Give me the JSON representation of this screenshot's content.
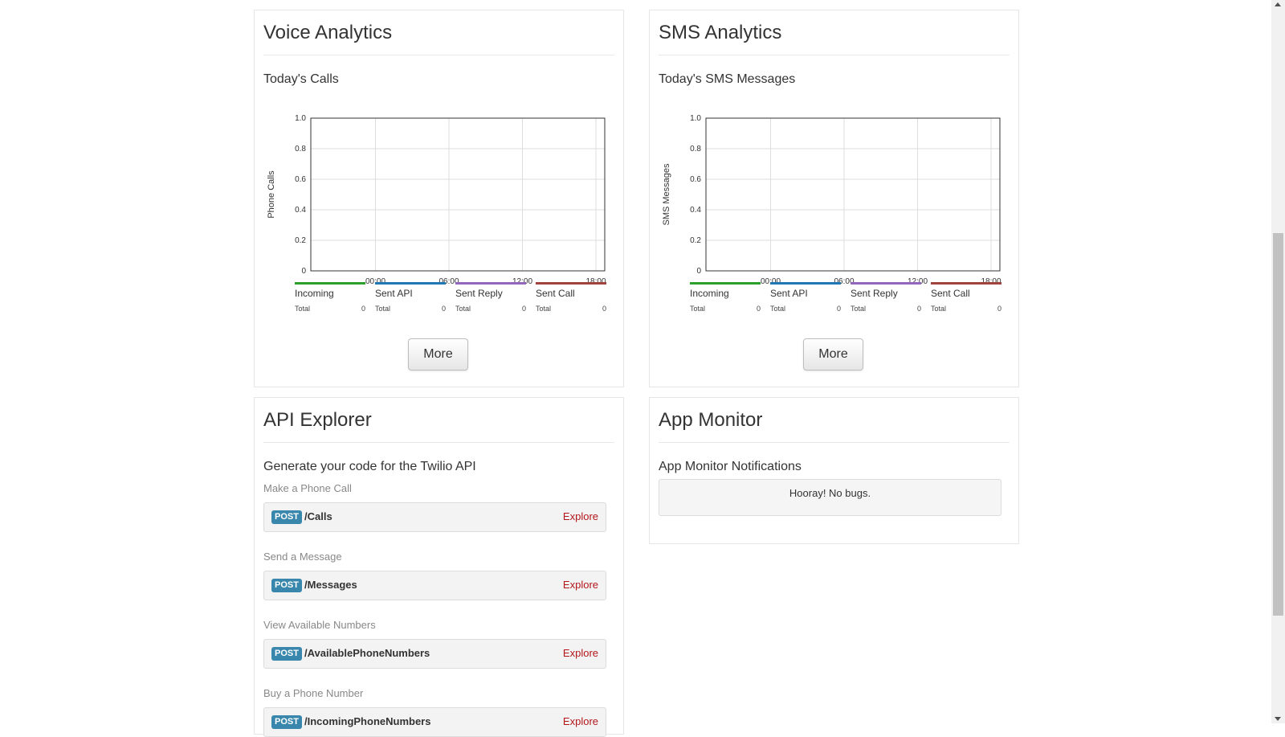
{
  "voice": {
    "title": "Voice Analytics",
    "subtitle": "Today's Calls",
    "more_label": "More",
    "legend": [
      {
        "name": "Incoming",
        "total_label": "Total",
        "total": "0",
        "color": "#2ca02c"
      },
      {
        "name": "Sent API",
        "total_label": "Total",
        "total": "0",
        "color": "#1f77b4"
      },
      {
        "name": "Sent Reply",
        "total_label": "Total",
        "total": "0",
        "color": "#9467bd"
      },
      {
        "name": "Sent Call",
        "total_label": "Total",
        "total": "0",
        "color": "#a0423d"
      }
    ]
  },
  "sms": {
    "title": "SMS Analytics",
    "subtitle": "Today's SMS Messages",
    "more_label": "More",
    "legend": [
      {
        "name": "Incoming",
        "total_label": "Total",
        "total": "0",
        "color": "#2ca02c"
      },
      {
        "name": "Sent API",
        "total_label": "Total",
        "total": "0",
        "color": "#1f77b4"
      },
      {
        "name": "Sent Reply",
        "total_label": "Total",
        "total": "0",
        "color": "#9467bd"
      },
      {
        "name": "Sent Call",
        "total_label": "Total",
        "total": "0",
        "color": "#a0423d"
      }
    ]
  },
  "api_explorer": {
    "title": "API Explorer",
    "subtitle": "Generate your code for the Twilio API",
    "items": [
      {
        "label": "Make a Phone Call",
        "method": "POST",
        "path": "/Calls",
        "action": "Explore"
      },
      {
        "label": "Send a Message",
        "method": "POST",
        "path": "/Messages",
        "action": "Explore"
      },
      {
        "label": "View Available Numbers",
        "method": "POST",
        "path": "/AvailablePhoneNumbers",
        "action": "Explore"
      },
      {
        "label": "Buy a Phone Number",
        "method": "POST",
        "path": "/IncomingPhoneNumbers",
        "action": "Explore"
      }
    ]
  },
  "app_monitor": {
    "title": "App Monitor",
    "subtitle": "App Monitor Notifications",
    "message": "Hooray! No bugs."
  },
  "chart_data": [
    {
      "type": "line",
      "ylabel": "Phone Calls",
      "xlabel": "",
      "x_ticks": [
        "00:00",
        "06:00",
        "12:00",
        "18:00"
      ],
      "y_ticks": [
        "0",
        "0.2",
        "0.4",
        "0.6",
        "0.8",
        "1.0"
      ],
      "ylim": [
        0,
        1.0
      ],
      "grid": true,
      "legend_placement": "bottom",
      "series": [
        {
          "name": "Incoming",
          "values": []
        },
        {
          "name": "Sent API",
          "values": []
        },
        {
          "name": "Sent Reply",
          "values": []
        },
        {
          "name": "Sent Call",
          "values": []
        }
      ]
    },
    {
      "type": "line",
      "ylabel": "SMS Messages",
      "xlabel": "",
      "x_ticks": [
        "00:00",
        "06:00",
        "12:00",
        "18:00"
      ],
      "y_ticks": [
        "0",
        "0.2",
        "0.4",
        "0.6",
        "0.8",
        "1.0"
      ],
      "ylim": [
        0,
        1.0
      ],
      "grid": true,
      "legend_placement": "bottom",
      "series": [
        {
          "name": "Incoming",
          "values": []
        },
        {
          "name": "Sent API",
          "values": []
        },
        {
          "name": "Sent Reply",
          "values": []
        },
        {
          "name": "Sent Call",
          "values": []
        }
      ]
    }
  ]
}
